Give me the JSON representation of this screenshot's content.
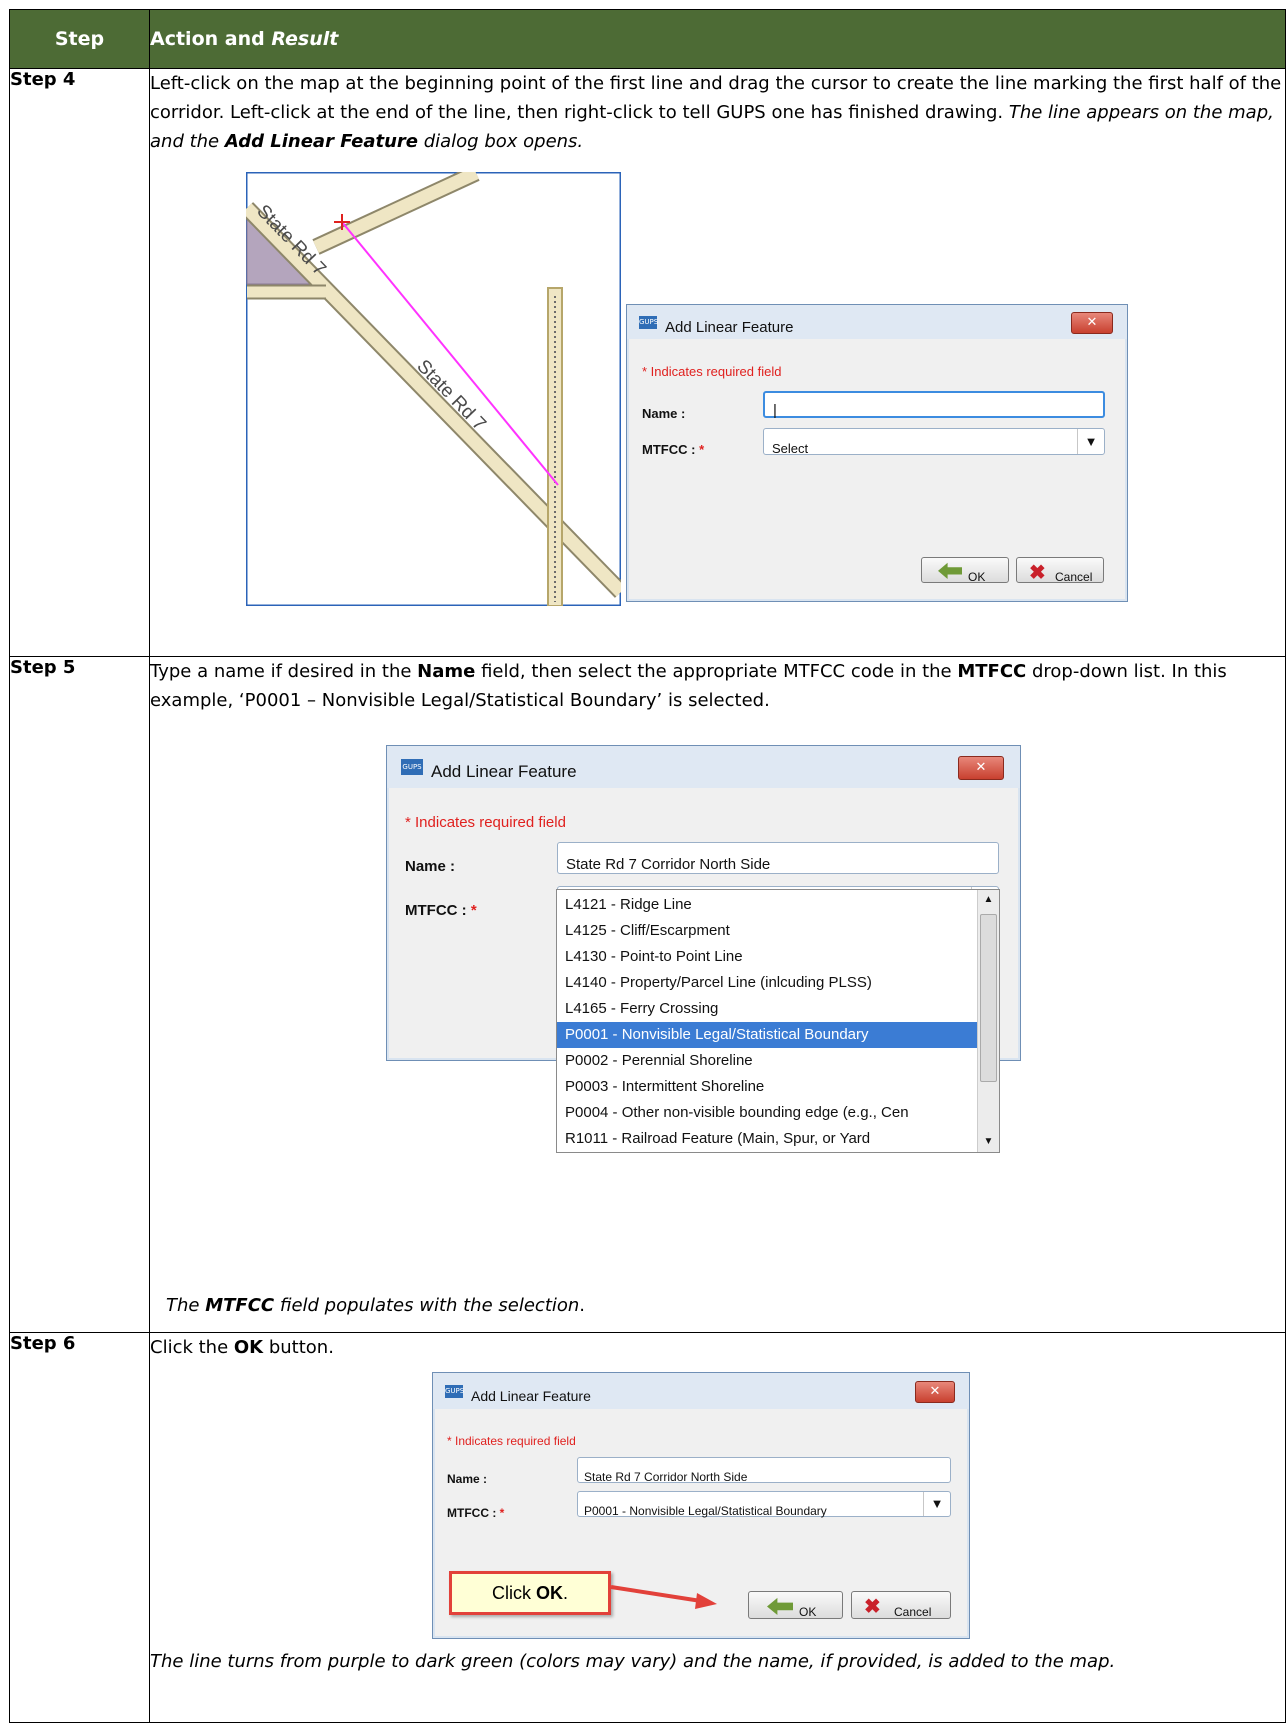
{
  "table": {
    "headers": {
      "step": "Step",
      "action": "Action and",
      "result": "Result"
    },
    "rows": [
      {
        "step": "Step 4",
        "text": {
          "a": "Left-click on the map at the beginning point of the first line and drag the cursor to create the line marking the first half of the corridor. Left-click at the end of the line, then right-click to tell GUPS one has finished drawing. ",
          "b": "The line appears on the map, and the ",
          "c": "Add Linear Feature",
          "d": " dialog box opens."
        }
      },
      {
        "step": "Step 5",
        "text": {
          "a": "Type a name if desired in the ",
          "b": "Name",
          "c": " field, then select the appropriate MTFCC code in the ",
          "d": "MTFCC",
          "e": " drop-down list. In this example, ‘P0001 – Nonvisible Legal/Statistical Boundary’ is selected."
        },
        "result": {
          "a": "The ",
          "b": "MTFCC",
          "c": " field populates with the selection",
          "d": "."
        }
      },
      {
        "step": "Step 6",
        "text": {
          "a": "Click the ",
          "b": "OK",
          "c": " button."
        },
        "result": "The line turns from purple to dark green (colors may vary) and the name, if provided, is added to the map."
      }
    ]
  },
  "map": {
    "road_label_1": "State Rd 7",
    "road_label_2": "State Rd 7"
  },
  "dialog": {
    "app_icon": "GUPS",
    "title": "Add Linear Feature",
    "close": "✕",
    "required_note": "* Indicates required field",
    "name_label": "Name :",
    "mtfcc_label": "MTFCC :",
    "required_star": "*",
    "select_placeholder": "Select",
    "ok": "OK",
    "cancel": "Cancel"
  },
  "step5_dialog": {
    "name_value": "State Rd 7 Corridor North Side",
    "options": [
      "L4121 - Ridge Line",
      "L4125 - Cliff/Escarpment",
      "L4130 - Point-to Point Line",
      "L4140 - Property/Parcel Line (inlcuding PLSS)",
      "L4165 - Ferry Crossing",
      "P0001 - Nonvisible Legal/Statistical Boundary",
      "P0002 - Perennial Shoreline",
      "P0003 - Intermittent Shoreline",
      "P0004 - Other non-visible bounding edge (e.g., Cen",
      "R1011 - Railroad Feature (Main, Spur, or Yard"
    ],
    "selected_option": "P0001 - Nonvisible Legal/Statistical Boundary"
  },
  "step6_dialog": {
    "name_value": "State Rd 7 Corridor North Side",
    "mtfcc_value": "P0001 - Nonvisible Legal/Statistical Boundary",
    "callout_a": "Click ",
    "callout_b": "OK",
    "callout_c": "."
  },
  "colors": {
    "header_bg": "#4d6b35",
    "selection": "#3b7cd4",
    "required": "#e0211f",
    "drawn_line": "#ff33ff"
  }
}
